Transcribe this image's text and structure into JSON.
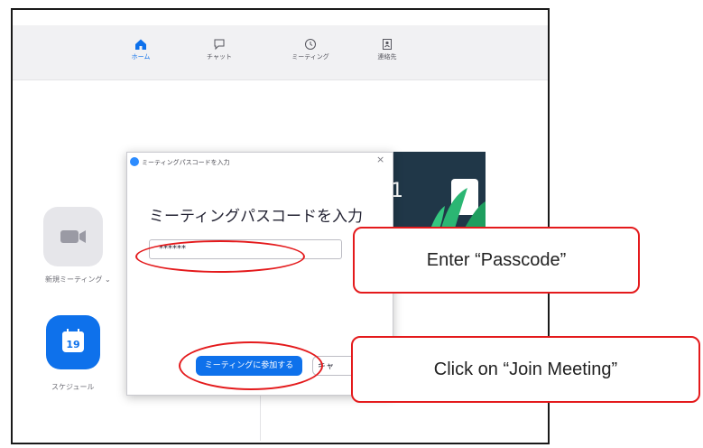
{
  "nav": {
    "home": "ホーム",
    "chat": "チャット",
    "meeting": "ミーティング",
    "contacts": "連絡先"
  },
  "sidebar": {
    "new_meeting": "新規ミーティング ⌄",
    "schedule": "スケジュール",
    "calendar_day": "19"
  },
  "background": {
    "partial_number": "1"
  },
  "dialog": {
    "title": "ミーティングパスコードを入力",
    "heading": "ミーティングパスコードを入力",
    "passcode_value": "******",
    "join_label": "ミーティングに参加する",
    "cancel_label": "キャ"
  },
  "annotations": {
    "enter_passcode": "Enter “Passcode”",
    "click_join": "Click on “Join Meeting”"
  },
  "colors": {
    "accent": "#0e71eb",
    "annotation": "#e41a1c"
  }
}
